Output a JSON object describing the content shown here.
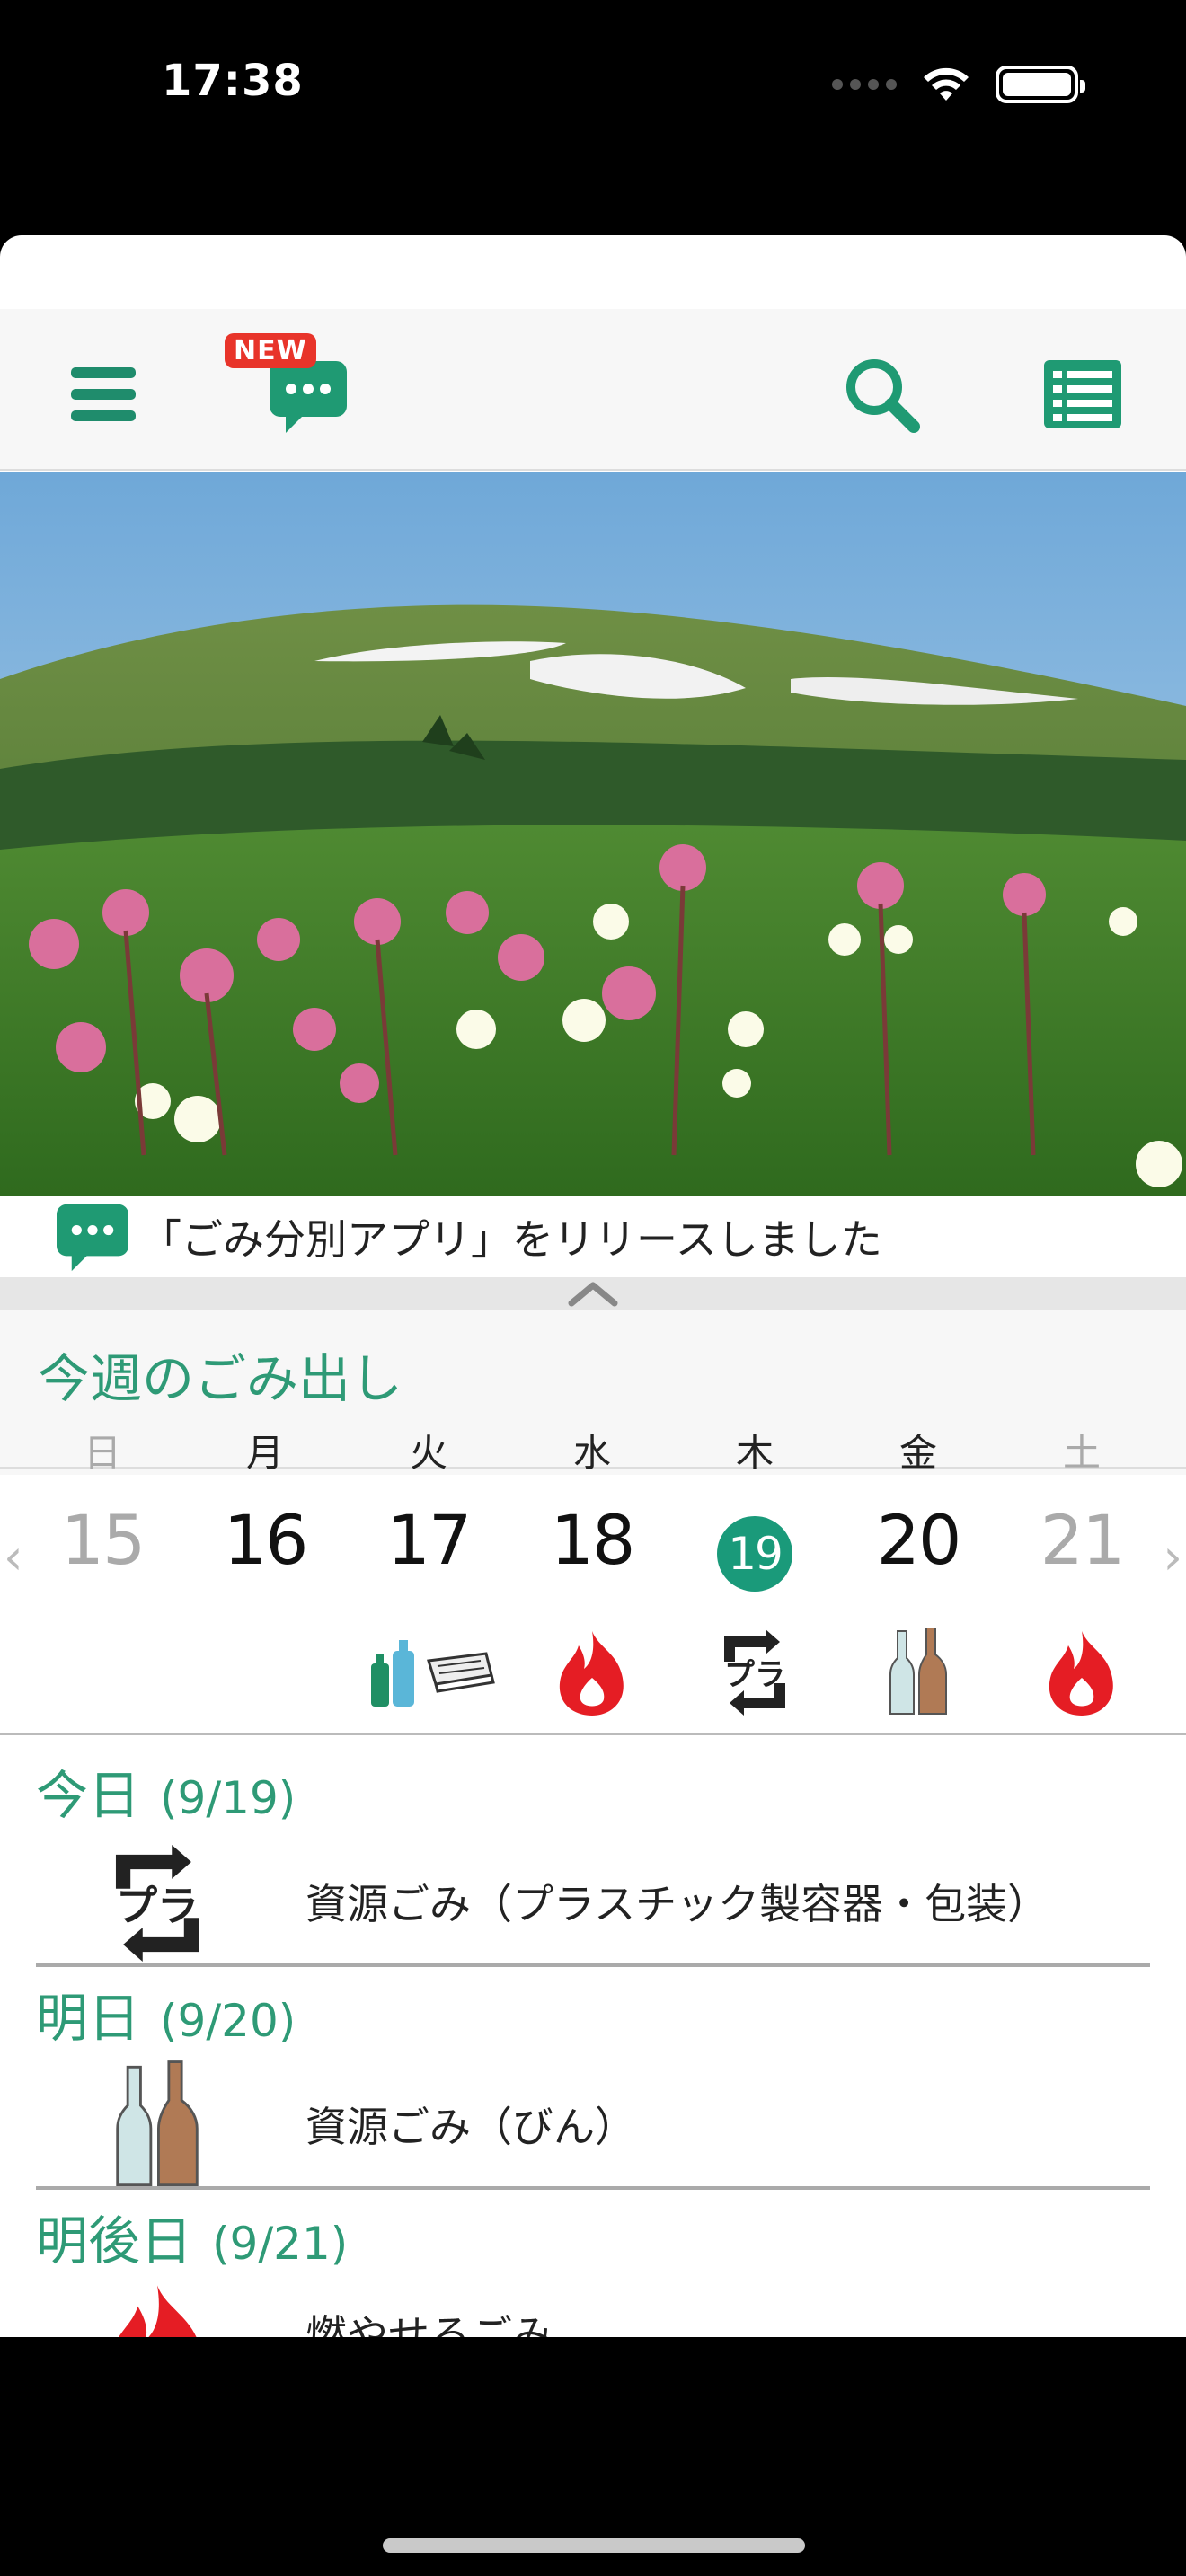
{
  "status_bar": {
    "time": "17:38"
  },
  "toolbar": {
    "new_badge": "NEW"
  },
  "news": {
    "text": "「ごみ分別アプリ」をリリースしました"
  },
  "week": {
    "title": "今週のごみ出し",
    "days_of_week": [
      "日",
      "月",
      "火",
      "水",
      "木",
      "金",
      "土"
    ],
    "dates": [
      "15",
      "16",
      "17",
      "18",
      "19",
      "20",
      "21"
    ],
    "today_index": 4,
    "day_icons": [
      "",
      "",
      "bottle-tray-icon",
      "fire-icon",
      "plastic-recycle-icon",
      "glass-bottle-icon",
      "fire-icon"
    ]
  },
  "schedule": [
    {
      "label": "今日",
      "date": "(9/19)",
      "icon": "plastic-recycle-icon",
      "name": "資源ごみ（プラスチック製容器・包装）"
    },
    {
      "label": "明日",
      "date": "(9/20)",
      "icon": "glass-bottle-icon",
      "name": "資源ごみ（びん）"
    },
    {
      "label": "明後日",
      "date": "(9/21)",
      "icon": "fire-icon",
      "name": "燃やせるごみ"
    }
  ],
  "colors": {
    "accent": "#2e9a76",
    "today_circle": "#1a9a7a",
    "fire": "#e51d24",
    "new_badge": "#e8342a"
  }
}
